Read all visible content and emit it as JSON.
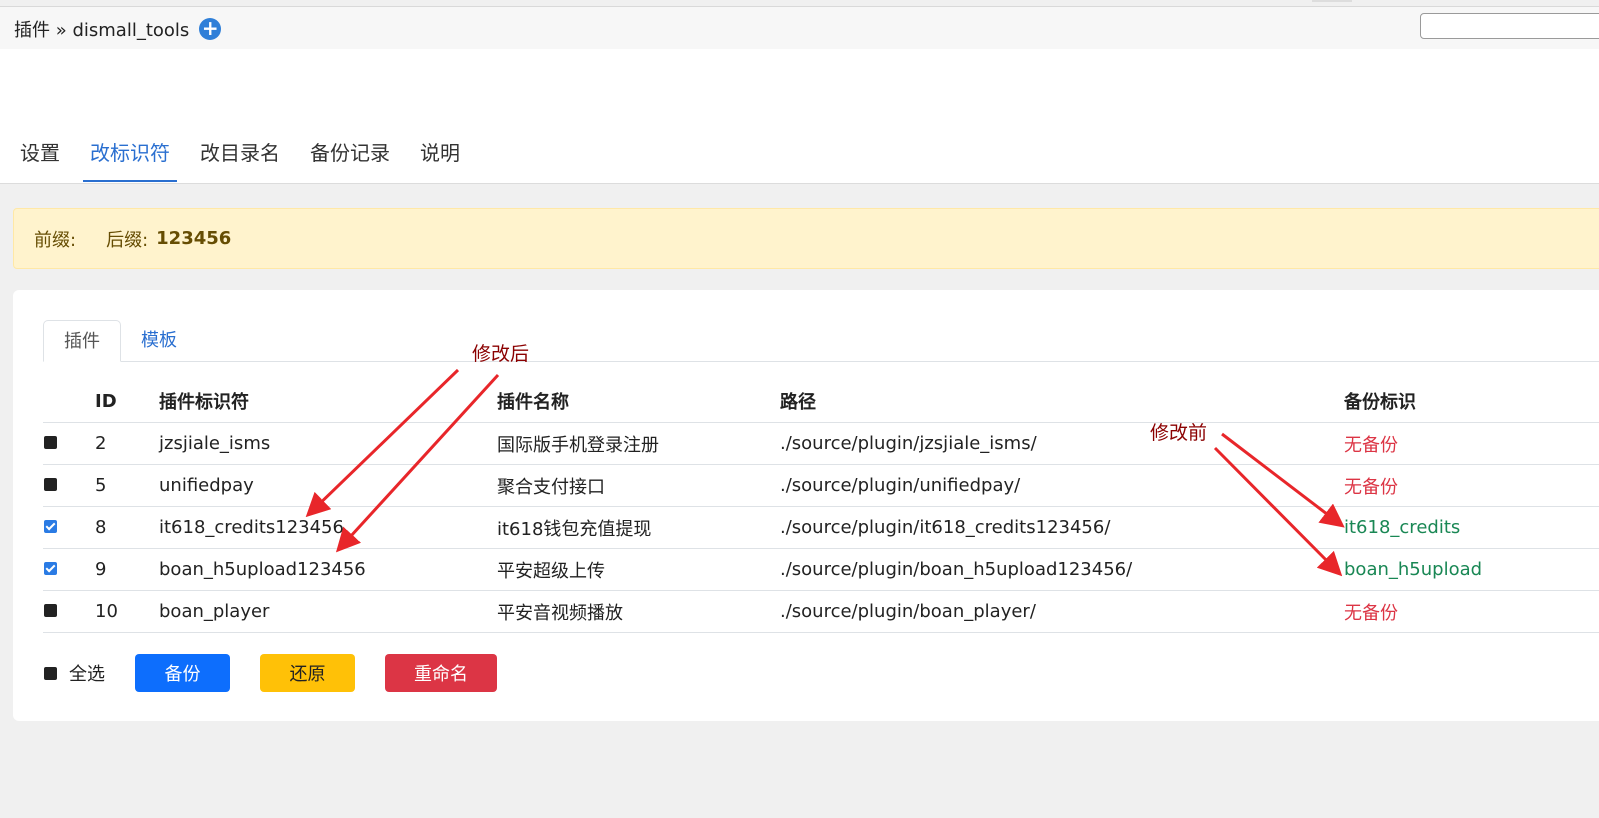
{
  "header": {
    "breadcrumb": "插件 » dismall_tools",
    "add_icon": "plus-circle-icon"
  },
  "nav": {
    "tabs": [
      "设置",
      "改标识符",
      "改目录名",
      "备份记录",
      "说明"
    ],
    "active_index": 1
  },
  "alert": {
    "prefix_label": "前缀:",
    "prefix_value": "",
    "suffix_label": "后缀:",
    "suffix_value": "123456"
  },
  "subtabs": {
    "items": [
      "插件",
      "模板"
    ],
    "active_index": 0
  },
  "table": {
    "headers": [
      "ID",
      "插件标识符",
      "插件名称",
      "路径",
      "备份标识"
    ],
    "rows": [
      {
        "checked": false,
        "id": "2",
        "identifier": "jzsjiale_isms",
        "name": "国际版手机登录注册",
        "path": "./source/plugin/jzsjiale_isms/",
        "backup": "无备份",
        "backup_status": "none"
      },
      {
        "checked": false,
        "id": "5",
        "identifier": "unifiedpay",
        "name": "聚合支付接口",
        "path": "./source/plugin/unifiedpay/",
        "backup": "无备份",
        "backup_status": "none"
      },
      {
        "checked": true,
        "id": "8",
        "identifier": "it618_credits123456",
        "name": "it618钱包充值提现",
        "path": "./source/plugin/it618_credits123456/",
        "backup": "it618_credits",
        "backup_status": "ok"
      },
      {
        "checked": true,
        "id": "9",
        "identifier": "boan_h5upload123456",
        "name": "平安超级上传",
        "path": "./source/plugin/boan_h5upload123456/",
        "backup": "boan_h5upload",
        "backup_status": "ok"
      },
      {
        "checked": false,
        "id": "10",
        "identifier": "boan_player",
        "name": "平安音视频播放",
        "path": "./source/plugin/boan_player/",
        "backup": "无备份",
        "backup_status": "none"
      }
    ]
  },
  "actions": {
    "select_all": "全选",
    "backup": "备份",
    "restore": "还原",
    "rename": "重命名"
  },
  "annotations": {
    "after": "修改后",
    "before": "修改前"
  },
  "colors": {
    "accent": "#2a6fd0",
    "danger": "#dc3545",
    "success": "#198754",
    "warning": "#ffc107",
    "primary": "#0d6efd",
    "annotation": "#8b0000",
    "arrow": "#e8262a"
  }
}
